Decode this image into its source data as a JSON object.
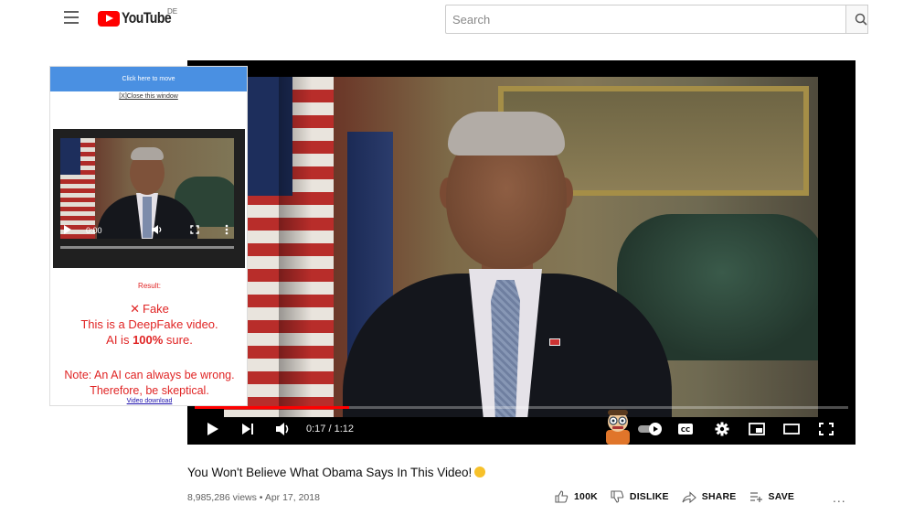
{
  "header": {
    "logo_text": "YouTube",
    "country_code": "DE",
    "search_placeholder": "Search"
  },
  "player": {
    "time": "0:17 / 1:12",
    "progress_fraction": 0.236
  },
  "overlay": {
    "drag_label": "Click here to move",
    "close_label": "[X]Close this window",
    "mini_time": "0:00",
    "result_label": "Result:",
    "verdict": "Fake",
    "line1": "This is a DeepFake video.",
    "line2_prefix": "AI is ",
    "line2_value": "100%",
    "line2_suffix": " sure.",
    "note_line1": "Note: An AI can always be wrong.",
    "note_line2": "Therefore, be skeptical.",
    "download_label": "Video download"
  },
  "video": {
    "title": "You Won't Believe What Obama Says In This Video!",
    "meta": "8,985,286 views • Apr 17, 2018",
    "likes": "100K",
    "dislike_label": "DISLIKE",
    "share_label": "SHARE",
    "save_label": "SAVE",
    "more_label": "..."
  },
  "colors": {
    "brand_red": "#ff0000",
    "overlay_blue": "#4a90e2",
    "result_red": "#e02424"
  },
  "icons": [
    "menu-icon",
    "youtube-logo-icon",
    "search-icon",
    "play-icon",
    "next-icon",
    "volume-icon",
    "mascot-icon",
    "autoplay-toggle-icon",
    "captions-icon",
    "settings-icon",
    "miniplayer-icon",
    "theater-icon",
    "fullscreen-icon",
    "like-icon",
    "dislike-icon",
    "share-icon",
    "save-icon"
  ]
}
